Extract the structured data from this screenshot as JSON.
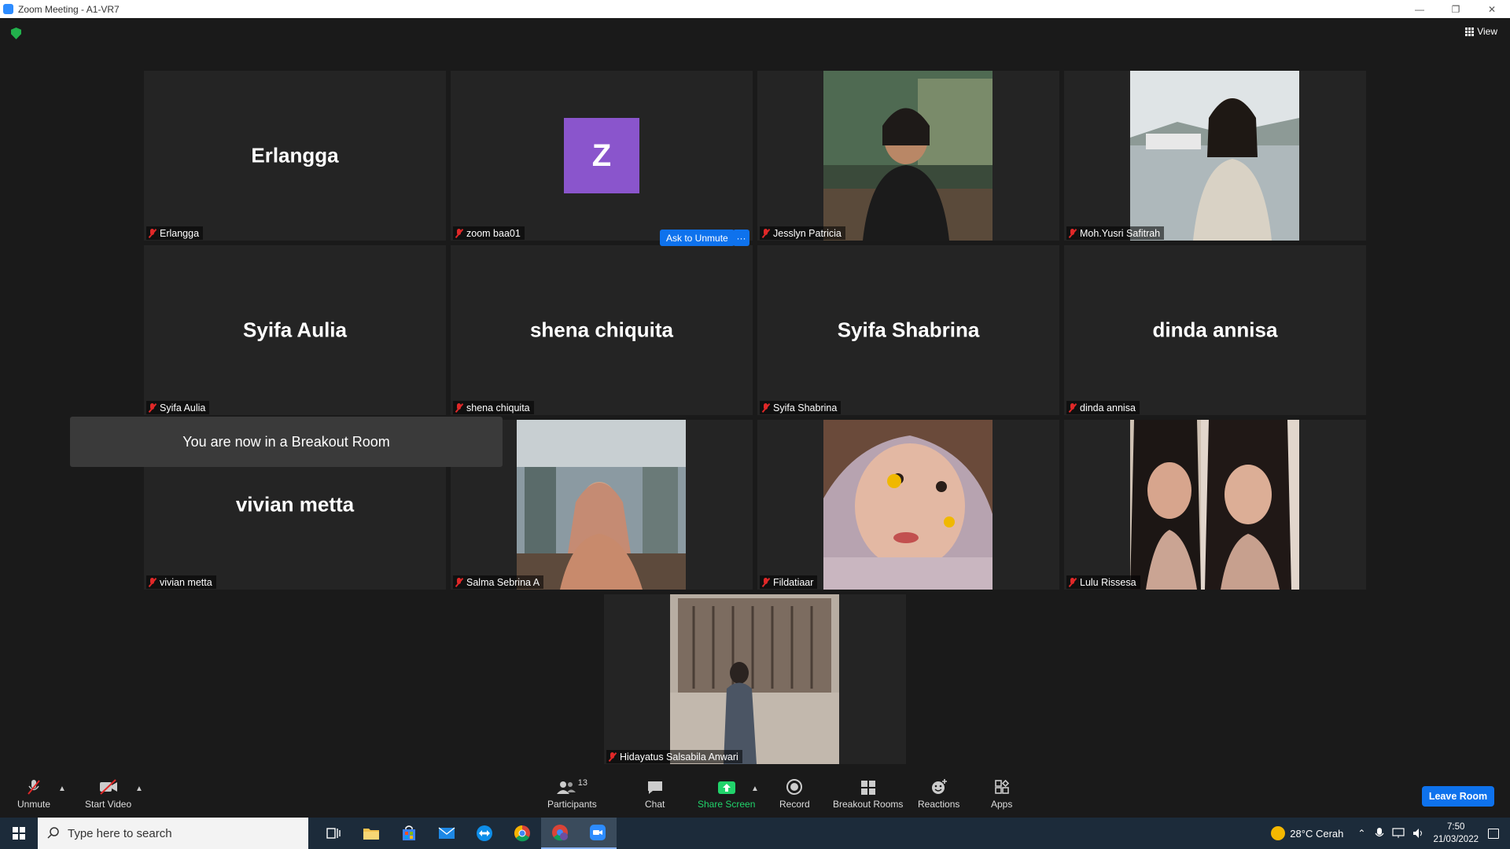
{
  "window": {
    "title": "Zoom Meeting - A1-VR7"
  },
  "header": {
    "view_label": "View"
  },
  "tiles": [
    {
      "name": "Erlangga",
      "big_name": "Erlangga"
    },
    {
      "name": "zoom baa01",
      "initial": "Z"
    },
    {
      "name": "Jesslyn Patricia"
    },
    {
      "name": "Moh.Yusri Safitrah"
    },
    {
      "name": "Syifa Aulia",
      "big_name": "Syifa Aulia"
    },
    {
      "name": "shena chiquita",
      "big_name": "shena chiquita"
    },
    {
      "name": "Syifa Shabrina",
      "big_name": "Syifa Shabrina"
    },
    {
      "name": "dinda annisa",
      "big_name": "dinda annisa"
    },
    {
      "name": "vivian metta",
      "big_name": "vivian metta"
    },
    {
      "name": "Salma Sebrina A"
    },
    {
      "name": "Fildatiaar"
    },
    {
      "name": "Lulu Rissesa"
    },
    {
      "name": "Hidayatus Salsabila Anwari"
    }
  ],
  "hover_actions": {
    "ask_unmute": "Ask to Unmute",
    "more": "···"
  },
  "toast": {
    "text": "You are now in a Breakout Room"
  },
  "toolbar": {
    "unmute": "Unmute",
    "start_video": "Start Video",
    "participants": "Participants",
    "participants_count": "13",
    "chat": "Chat",
    "share_screen": "Share Screen",
    "record": "Record",
    "breakout_rooms": "Breakout Rooms",
    "reactions": "Reactions",
    "apps": "Apps",
    "leave": "Leave Room"
  },
  "taskbar": {
    "search_placeholder": "Type here to search",
    "weather": "28°C  Cerah",
    "time": "7:50",
    "date": "21/03/2022"
  },
  "colors": {
    "accent": "#0e72ed",
    "muted": "#e02828",
    "share": "#21d36b",
    "avatar": "#8a55cc"
  }
}
